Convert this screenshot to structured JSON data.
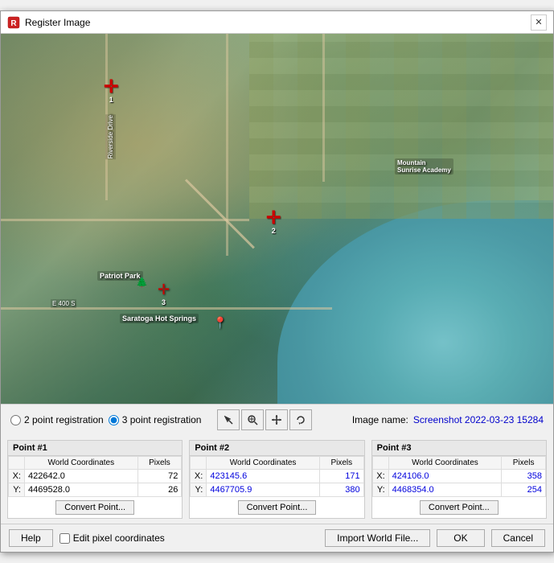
{
  "window": {
    "title": "Register Image",
    "close_label": "✕"
  },
  "map": {
    "alt": "Satellite map view of Saratoga area"
  },
  "toolbar": {
    "radio_2pt": "2 point registration",
    "radio_3pt": "3 point registration",
    "radio_2pt_checked": false,
    "radio_3pt_checked": true,
    "tools": [
      {
        "name": "pointer-tool",
        "icon": "⊹",
        "label": "pointer"
      },
      {
        "name": "zoom-tool",
        "icon": "🔍",
        "label": "zoom"
      },
      {
        "name": "pan-tool",
        "icon": "✛",
        "label": "pan"
      },
      {
        "name": "rotate-tool",
        "icon": "↻",
        "label": "rotate"
      }
    ],
    "image_name_label": "Image name:",
    "image_name_value": "Screenshot 2022-03-23 15284"
  },
  "points": [
    {
      "id": "point1",
      "header": "Point #1",
      "world_coords_label": "World Coordinates",
      "pixels_label": "Pixels",
      "x_label": "X:",
      "y_label": "Y:",
      "x_world": "422642.0",
      "y_world": "4469528.0",
      "x_pixel": "72",
      "y_pixel": "26",
      "convert_btn": "Convert Point..."
    },
    {
      "id": "point2",
      "header": "Point #2",
      "world_coords_label": "World Coordinates",
      "pixels_label": "Pixels",
      "x_label": "X:",
      "y_label": "Y:",
      "x_world": "423145.6",
      "y_world": "4467705.9",
      "x_pixel": "171",
      "y_pixel": "380",
      "convert_btn": "Convert Point..."
    },
    {
      "id": "point3",
      "header": "Point #3",
      "world_coords_label": "World Coordinates",
      "pixels_label": "Pixels",
      "x_label": "X:",
      "y_label": "Y:",
      "x_world": "424106.0",
      "y_world": "4468354.0",
      "x_pixel": "358",
      "y_pixel": "254",
      "convert_btn": "Convert Point..."
    }
  ],
  "bottom_bar": {
    "help_label": "Help",
    "edit_pixels_label": "Edit pixel coordinates",
    "import_label": "Import World File...",
    "ok_label": "OK",
    "cancel_label": "Cancel"
  }
}
